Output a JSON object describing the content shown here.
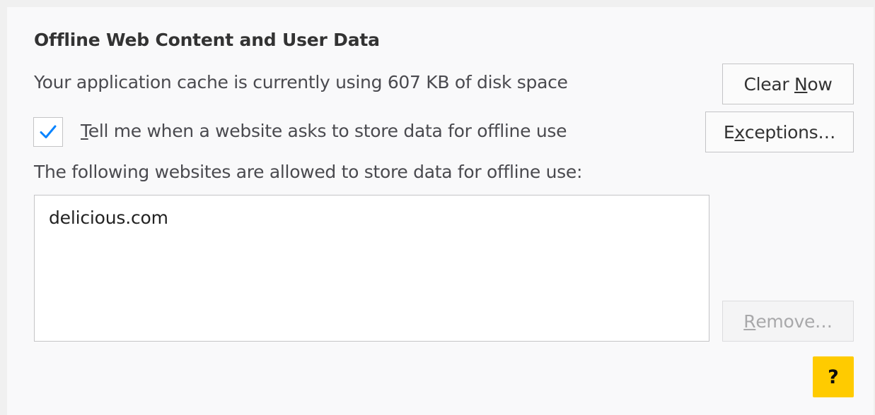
{
  "section": {
    "title": "Offline Web Content and User Data",
    "cache_text": "Your application cache is currently using 607 KB of disk space",
    "clear_now_button": {
      "label_before": "Clear ",
      "label_accel": "N",
      "label_after": "ow"
    },
    "notify_checkbox": {
      "checked": true,
      "label_accel": "T",
      "label_rest": "ell me when a website asks to store data for offline use"
    },
    "exceptions_button": {
      "label_before": "E",
      "label_accel": "x",
      "label_after": "ceptions…"
    },
    "allowed_label": "The following websites are allowed to store data for offline use:",
    "websites": [
      "delicious.com"
    ],
    "remove_button": {
      "label_accel": "R",
      "label_after": "emove…",
      "disabled": true
    },
    "help_button": {
      "label": "?"
    }
  },
  "colors": {
    "panel_background": "#f9f9fa",
    "checkmark": "#0a84ff",
    "help_button": "#ffcb00"
  }
}
